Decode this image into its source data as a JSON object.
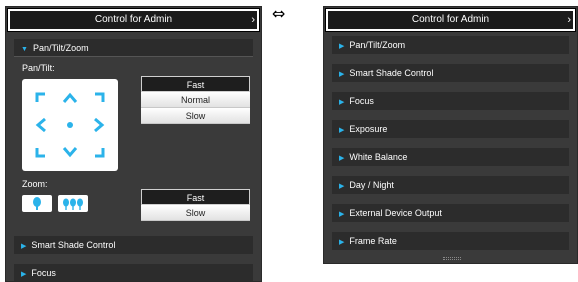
{
  "comparison_arrow": "⇔",
  "left_panel": {
    "title": "Control for Admin",
    "ptz_section": "Pan/Tilt/Zoom",
    "pan_tilt_label": "Pan/Tilt:",
    "pan_tilt_speeds": [
      "Fast",
      "Normal",
      "Slow"
    ],
    "pan_tilt_active": "Fast",
    "zoom_label": "Zoom:",
    "zoom_speeds": [
      "Fast",
      "Slow"
    ],
    "zoom_active": "Fast",
    "sections": [
      "Smart Shade Control",
      "Focus"
    ]
  },
  "right_panel": {
    "title": "Control for Admin",
    "sections": [
      "Pan/Tilt/Zoom",
      "Smart Shade Control",
      "Focus",
      "Exposure",
      "White Balance",
      "Day / Night",
      "External Device Output",
      "Frame Rate"
    ]
  },
  "colors": {
    "accent": "#2bb3ea",
    "panel_bg": "#3a3a3a",
    "bar_bg": "#2c2c2c",
    "header_bg": "#1b1b1b"
  },
  "icons": {
    "pad": [
      "up-left-arrow-icon",
      "up-arrow-icon",
      "up-right-arrow-icon",
      "left-arrow-icon",
      "home-dot-icon",
      "right-arrow-icon",
      "down-left-arrow-icon",
      "down-arrow-icon",
      "down-right-arrow-icon"
    ],
    "zoom": [
      "zoom-wide-tree-icon",
      "zoom-tele-trees-icon"
    ]
  }
}
